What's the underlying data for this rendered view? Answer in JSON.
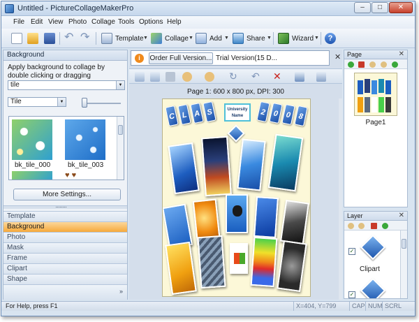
{
  "window": {
    "title": "Untitled - PictureCollageMakerPro"
  },
  "menu": [
    "File",
    "Edit",
    "View",
    "Photo",
    "Collage",
    "Tools",
    "Options",
    "Help"
  ],
  "toolbar": {
    "template": "Template",
    "collage": "Collage",
    "add": "Add",
    "share": "Share",
    "wizard": "Wizard"
  },
  "left_panel": {
    "header": "Background",
    "instruction": "Apply background to collage by double clicking or dragging",
    "category_select": "tile",
    "mode_select": "Tile",
    "tiles": [
      {
        "label": "bk_tile_000"
      },
      {
        "label": "bk_tile_003"
      }
    ],
    "more_settings": "More Settings...",
    "nav": [
      "Template",
      "Background",
      "Photo",
      "Mask",
      "Frame",
      "Clipart",
      "Shape"
    ],
    "active_nav": "Background"
  },
  "center": {
    "order_button": "Order Full Version...",
    "trial_text": "Trial Version(15 D...",
    "page_info": "Page 1: 600 x 800 px, DPI: 300",
    "badge_text": "University Name"
  },
  "page_panel": {
    "header": "Page",
    "thumb_label": "Page1"
  },
  "layer_panel": {
    "header": "Layer",
    "item_label": "Clipart"
  },
  "status": {
    "help": "For Help, press F1",
    "coords": "X=404, Y=799",
    "cap": "CAP",
    "num": "NUM",
    "scrl": "SCRL"
  },
  "colors": {
    "accent_active": "#f6a93b",
    "chrome_blue": "#d8e4f0",
    "canvas_bg": "#fcf8d8"
  }
}
